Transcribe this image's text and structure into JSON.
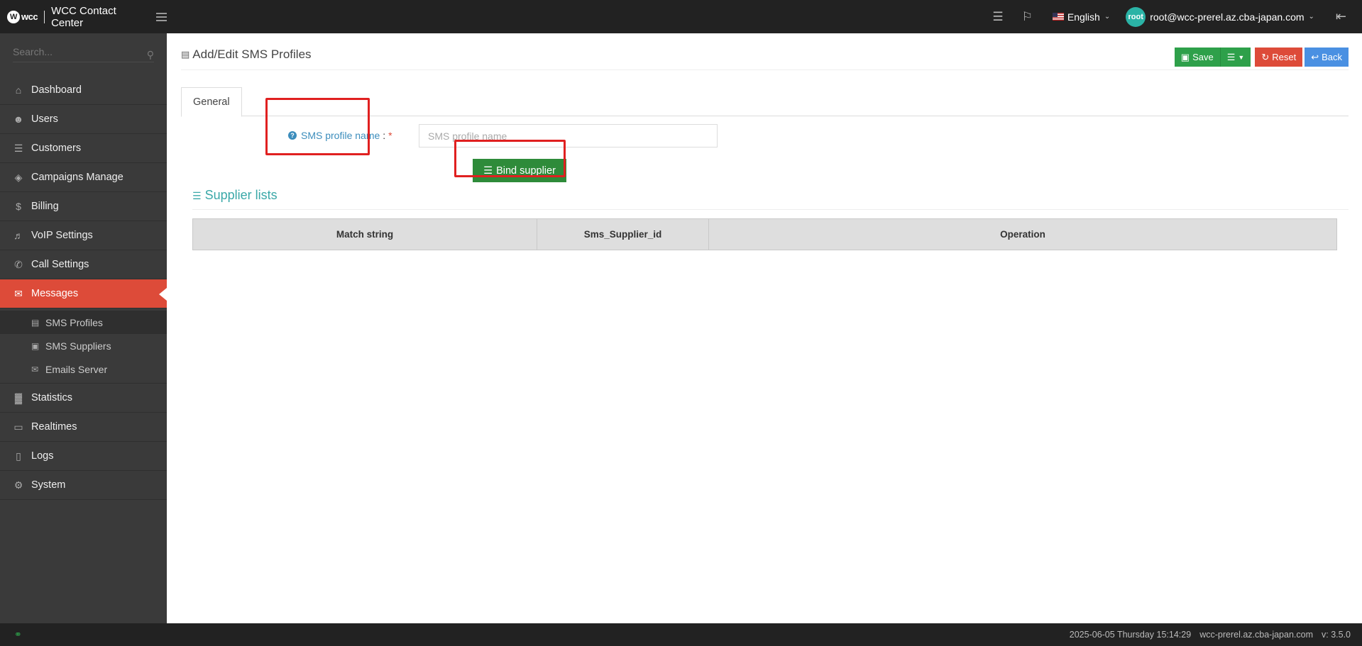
{
  "header": {
    "logo_text": "wcc",
    "app_title": "WCC Contact Center",
    "language": "English",
    "user_avatar": "root",
    "user_email": "root@wcc-prerel.az.cba-japan.com"
  },
  "sidebar": {
    "search_placeholder": "Search...",
    "items": [
      {
        "label": "Dashboard",
        "icon": "home-icon"
      },
      {
        "label": "Users",
        "icon": "user-icon"
      },
      {
        "label": "Customers",
        "icon": "database-icon"
      },
      {
        "label": "Campaigns Manage",
        "icon": "layers-icon"
      },
      {
        "label": "Billing",
        "icon": "dollar-icon"
      },
      {
        "label": "VoIP Settings",
        "icon": "volume-icon"
      },
      {
        "label": "Call Settings",
        "icon": "phone-icon"
      },
      {
        "label": "Messages",
        "icon": "envelope-icon"
      }
    ],
    "subitems": [
      {
        "label": "SMS Profiles",
        "icon": "file-icon"
      },
      {
        "label": "SMS Suppliers",
        "icon": "briefcase-icon"
      },
      {
        "label": "Emails Server",
        "icon": "envelope-icon"
      }
    ],
    "items_after": [
      {
        "label": "Statistics",
        "icon": "bar-chart-icon"
      },
      {
        "label": "Realtimes",
        "icon": "monitor-icon"
      },
      {
        "label": "Logs",
        "icon": "book-icon"
      },
      {
        "label": "System",
        "icon": "gear-icon"
      }
    ]
  },
  "page": {
    "title": "Add/Edit SMS Profiles",
    "save_label": "Save",
    "reset_label": "Reset",
    "back_label": "Back",
    "tab_general": "General",
    "field_label": "SMS profile name",
    "field_colon": ":",
    "field_required": "*",
    "field_placeholder": "SMS profile name",
    "field_value": "",
    "bind_label": "Bind supplier",
    "section_title": "Supplier lists",
    "table_headers": [
      "Match string",
      "Sms_Supplier_id",
      "Operation"
    ]
  },
  "footer": {
    "datetime": "2025-06-05 Thursday 15:14:29",
    "host": "wcc-prerel.az.cba-japan.com",
    "version": "v: 3.5.0"
  },
  "colors": {
    "accent_red": "#dd4b39",
    "save_green": "#2ea04a",
    "back_blue": "#4a90e2",
    "section_teal": "#3aa8a8",
    "annotation_red": "#e02020"
  }
}
